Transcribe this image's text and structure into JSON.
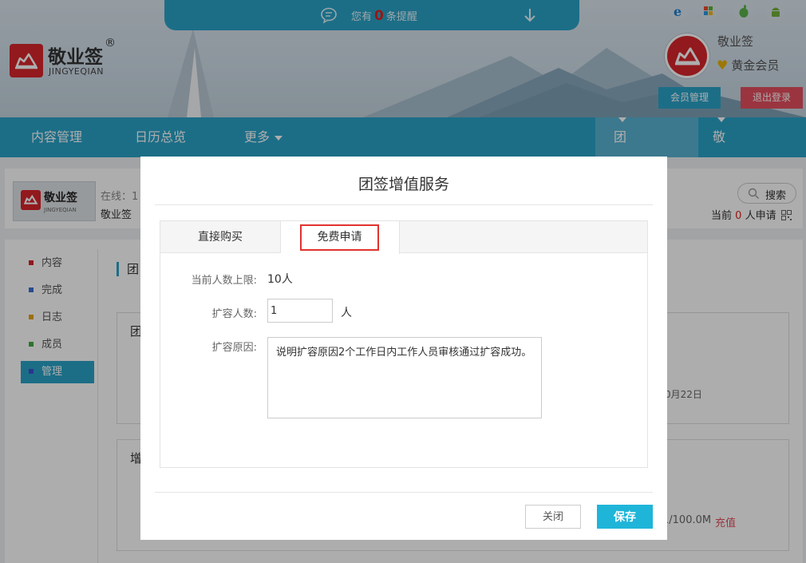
{
  "notice": {
    "prefix": "您有",
    "count": "0",
    "suffix": "条提醒"
  },
  "brand": {
    "name": "敬业签",
    "reg": "®",
    "en": "JINGYEQIAN"
  },
  "os_icons": [
    "ie-icon",
    "windows-icon",
    "apple-icon",
    "android-icon"
  ],
  "user": {
    "name": "敬业签",
    "level": "黄金会员",
    "member_btn": "会员管理",
    "logout_btn": "退出登录"
  },
  "nav": {
    "content": "内容管理",
    "calendar": "日历总览",
    "more": "更多",
    "team": "团队便签",
    "tools": "敬业小工具"
  },
  "team_bar": {
    "online": "在线：1",
    "team_name": "敬业签",
    "search": "搜索",
    "apply_prefix": "当前",
    "apply_count": "0",
    "apply_suffix": "人申请"
  },
  "sidebar": {
    "items": [
      "内容",
      "完成",
      "日志",
      "成员",
      "管理"
    ]
  },
  "main": {
    "section_title": "团",
    "card1_title": "团",
    "card2_title": "增",
    "bracket": "】",
    "date": "0月22日",
    "size": "1/100.0M",
    "charge": "充值"
  },
  "modal": {
    "title": "团签增值服务",
    "tabs": [
      "直接购买",
      "免费申请"
    ],
    "limit_label": "当前人数上限:",
    "limit_value": "10人",
    "expand_label": "扩容人数:",
    "expand_value": "1",
    "expand_unit": "人",
    "reason_label": "扩容原因:",
    "reason_value": "说明扩容原因2个工作日内工作人员审核通过扩容成功。",
    "close_btn": "关闭",
    "save_btn": "保存"
  },
  "colors": {
    "primary": "#2aa2c8",
    "brand_red": "#d8262b",
    "logout": "#e34f5f",
    "save": "#1eb5d9",
    "tab_highlight": "#e0332e"
  }
}
